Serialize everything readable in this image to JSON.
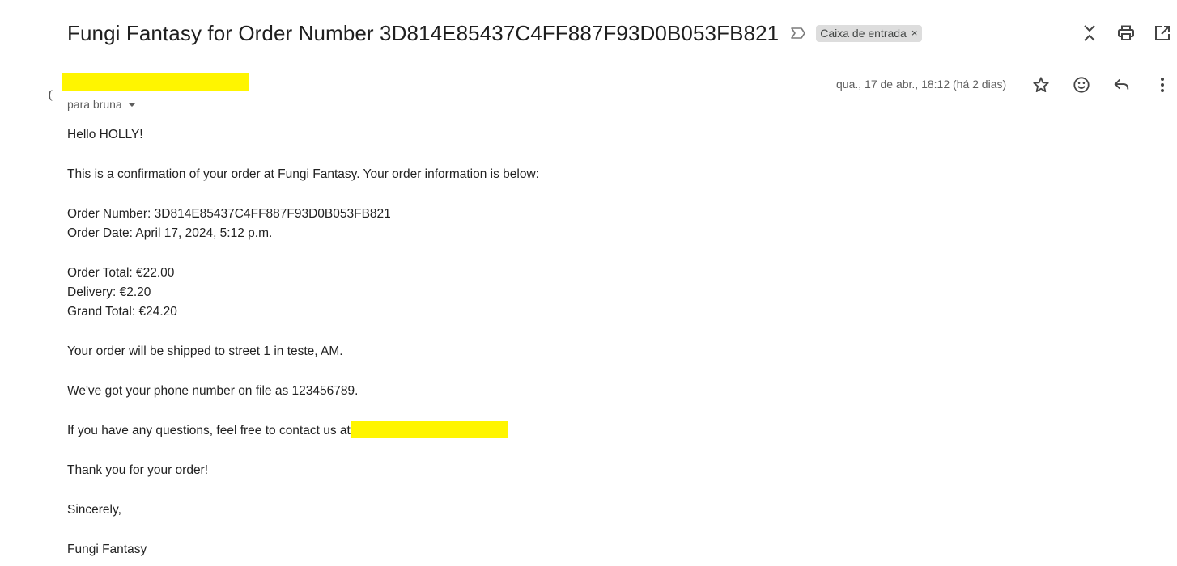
{
  "header": {
    "subject": "Fungi Fantasy for Order Number 3D814E85437C4FF887F93D0B053FB821",
    "label": "Caixa de entrada",
    "label_close": "×"
  },
  "icons": {
    "important": "important-marker-icon",
    "collapse": "collapse-all-icon",
    "print": "print-icon",
    "open_new_window": "open-in-new-window-icon",
    "star": "star-icon",
    "emoji": "emoji-reaction-icon",
    "reply": "reply-icon",
    "more": "more-vertical-icon"
  },
  "message": {
    "recipient": "para bruna",
    "date": "qua., 17 de abr., 18:12 (há 2 dias)",
    "body": {
      "greeting": "Hello HOLLY!",
      "intro": "This is a confirmation of your order at Fungi Fantasy. Your order information is below:",
      "order_number": "Order Number: 3D814E85437C4FF887F93D0B053FB821",
      "order_date": "Order Date: April 17, 2024, 5:12 p.m.",
      "order_total": "Order Total: €22.00",
      "delivery": "Delivery: €2.20",
      "grand_total": "Grand Total: €24.20",
      "shipping": "Your order will be shipped to street 1 in teste, AM.",
      "phone": "We've got your phone number on file as 123456789.",
      "contact": "If you have any questions, feel free to contact us at",
      "thanks": "Thank you for your order!",
      "closing": "Sincerely,",
      "signature": "Fungi Fantasy"
    }
  },
  "colors": {
    "redaction": "#fff500",
    "label_chip_bg": "#dddddd",
    "secondary_text": "#5e5e5e"
  }
}
